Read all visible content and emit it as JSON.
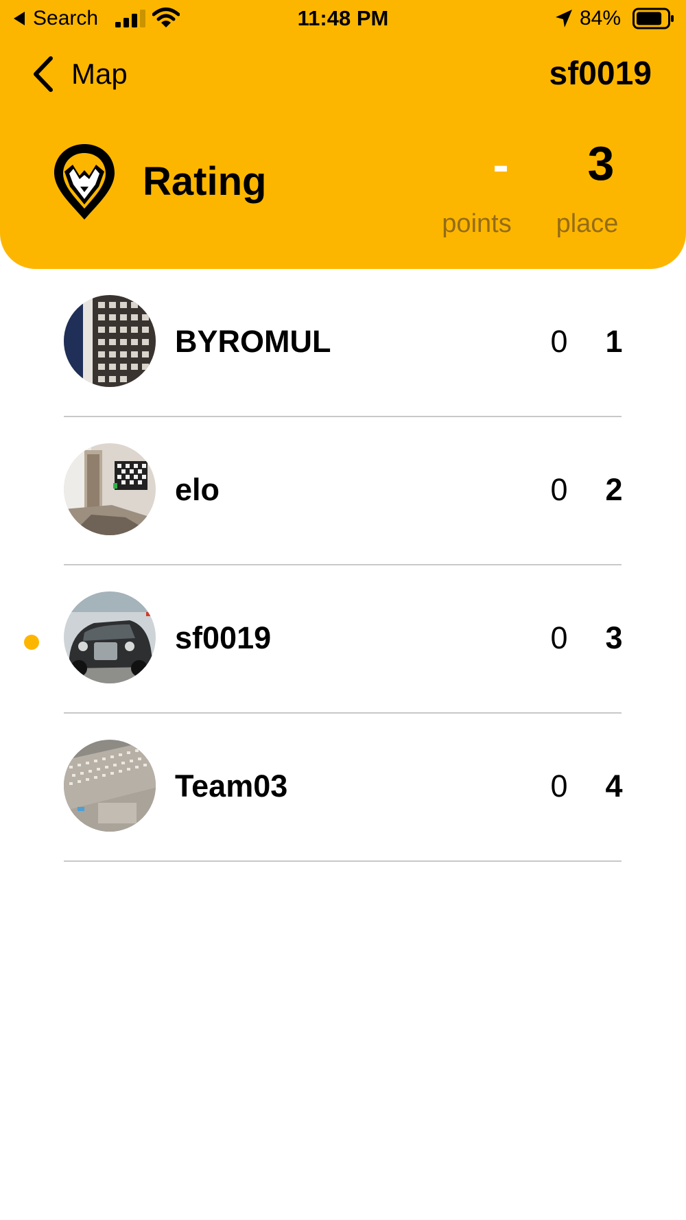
{
  "status_bar": {
    "back_app": "Search",
    "time": "11:48 PM",
    "battery_percent": "84%",
    "battery_level": 0.84,
    "icons": [
      "back-arrow-icon",
      "signal-icon",
      "wifi-icon",
      "location-arrow-icon",
      "battery-icon"
    ]
  },
  "nav": {
    "back_label": "Map",
    "title": "sf0019"
  },
  "header": {
    "title": "Rating",
    "points_value": "-",
    "points_label": "points",
    "place_value": "3",
    "place_label": "place"
  },
  "leaderboard": [
    {
      "name": "BYROMUL",
      "points": "0",
      "place": "1",
      "current": false
    },
    {
      "name": "elo",
      "points": "0",
      "place": "2",
      "current": false
    },
    {
      "name": "sf0019",
      "points": "0",
      "place": "3",
      "current": true
    },
    {
      "name": "Team03",
      "points": "0",
      "place": "4",
      "current": false
    }
  ],
  "colors": {
    "accent": "#FDB600",
    "muted_label": "#946c18",
    "divider": "#c8c8c8"
  }
}
